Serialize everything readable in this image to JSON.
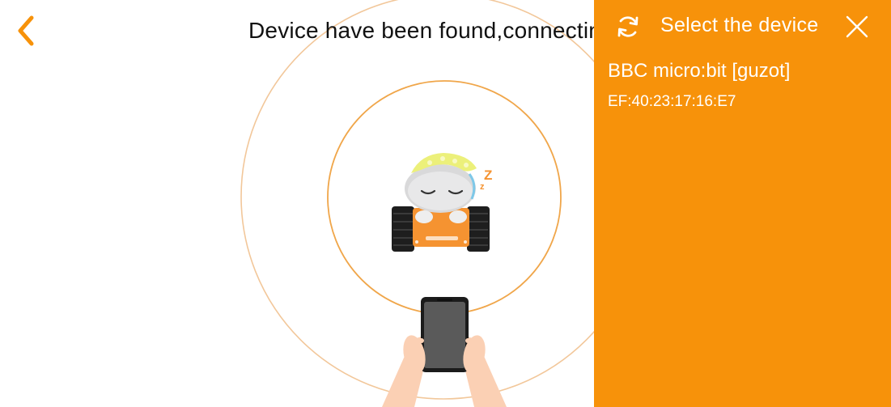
{
  "main": {
    "status_text": "Device have been found,connecting...",
    "back_icon": "chevron-left-icon"
  },
  "panel": {
    "title": "Select the device",
    "refresh_icon": "refresh-icon",
    "close_icon": "close-icon",
    "devices": [
      {
        "name": "BBC micro:bit [guzot]",
        "mac": "EF:40:23:17:16:E7"
      }
    ]
  },
  "colors": {
    "accent": "#f7920a",
    "ring": "#f0a64a",
    "robot_body": "#f59331",
    "robot_track": "#1e1e1e",
    "cap": "#ecf07a",
    "skin": "#fbd0b4"
  }
}
